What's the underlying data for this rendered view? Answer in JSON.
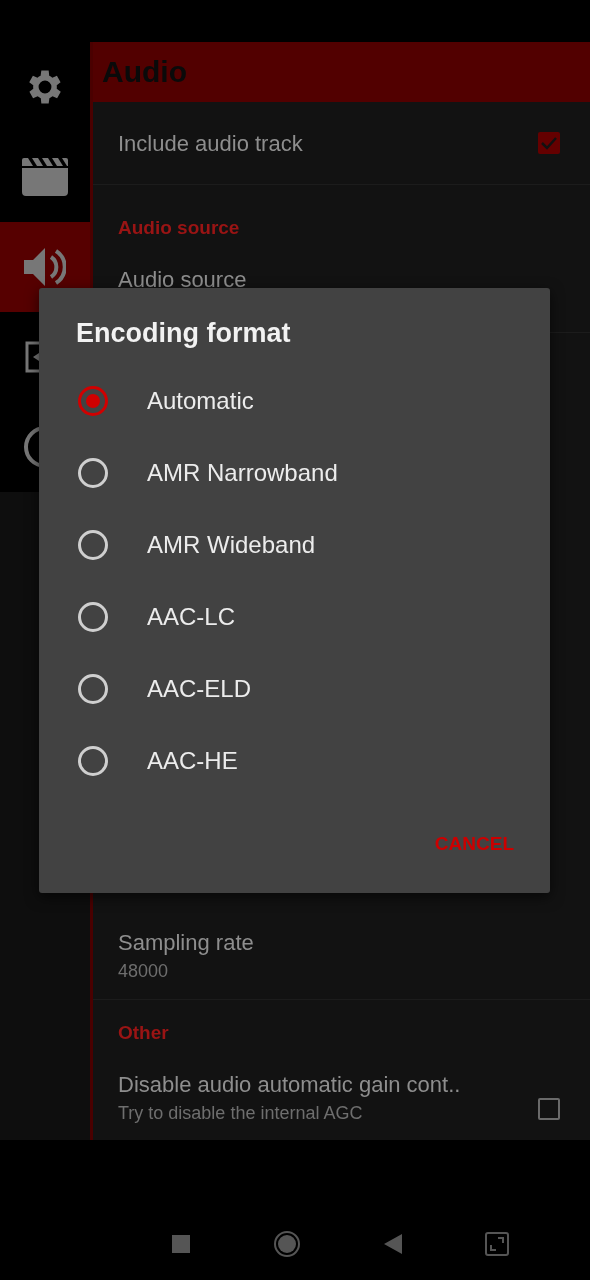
{
  "sidebar": {
    "items": [
      {
        "kind": "gear",
        "selected": false
      },
      {
        "kind": "clapper",
        "selected": false
      },
      {
        "kind": "speaker",
        "selected": true
      },
      {
        "kind": "frame",
        "selected": false
      },
      {
        "kind": "circle",
        "selected": false
      }
    ]
  },
  "header": {
    "title": "Audio"
  },
  "upper_settings": [
    {
      "kind": "checkbox",
      "title": "Include audio track",
      "checked": true
    },
    {
      "kind": "category",
      "title": "Audio source"
    },
    {
      "kind": "value",
      "title": "Audio source"
    }
  ],
  "lower_settings": [
    {
      "kind": "value",
      "title": "Sampling rate",
      "summary": "48000"
    },
    {
      "kind": "category",
      "title": "Other"
    },
    {
      "kind": "checkbox",
      "title": "Disable audio automatic gain cont..",
      "summary": "Try to disable the internal AGC",
      "checked": false
    }
  ],
  "dialog": {
    "title": "Encoding format",
    "options": [
      {
        "label": "Automatic",
        "selected": true
      },
      {
        "label": "AMR Narrowband",
        "selected": false
      },
      {
        "label": "AMR Wideband",
        "selected": false
      },
      {
        "label": "AAC-LC",
        "selected": false
      },
      {
        "label": "AAC-ELD",
        "selected": false
      },
      {
        "label": "AAC-HE",
        "selected": false
      }
    ],
    "buttons": [
      {
        "label": "CANCEL"
      }
    ]
  }
}
